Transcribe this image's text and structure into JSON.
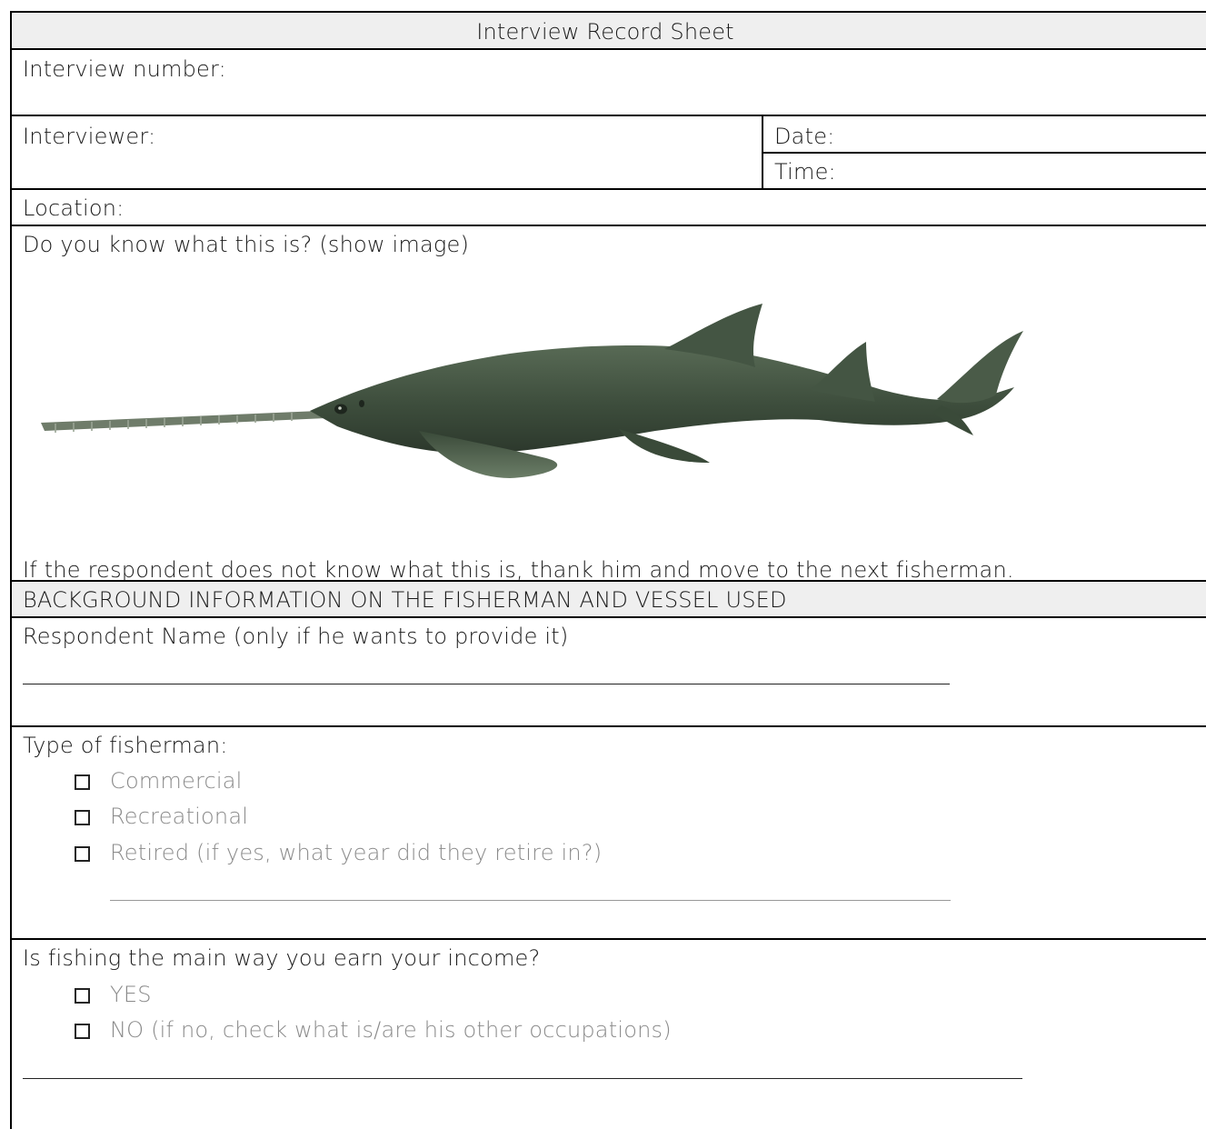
{
  "title": "Interview Record Sheet",
  "fields": {
    "interview_number": "Interview number:",
    "interviewer": "Interviewer:",
    "date": "Date:",
    "time": "Time:",
    "location": "Location:"
  },
  "question_image": {
    "prompt": "Do you know what this is? (show image)",
    "instruction": "If the respondent does not know what this is, thank him and move to the next fisherman.",
    "image_icon": "sawfish-illustration"
  },
  "section_background": "BACKGROUND INFORMATION ON THE FISHERMAN AND VESSEL USED",
  "respondent_name": "Respondent Name (only if he wants to provide it)",
  "fisherman_type": {
    "question": "Type of fisherman:",
    "options": [
      "Commercial",
      "Recreational",
      "Retired (if yes, what year did they retire in?)"
    ]
  },
  "income": {
    "question": "Is fishing the main way you earn your income?",
    "options": [
      "YES",
      "NO (if no, check what is/are his other occupations)"
    ]
  },
  "colors": {
    "header_bg": "#efefef",
    "option_text": "#8a8a8a",
    "border": "#000000"
  }
}
